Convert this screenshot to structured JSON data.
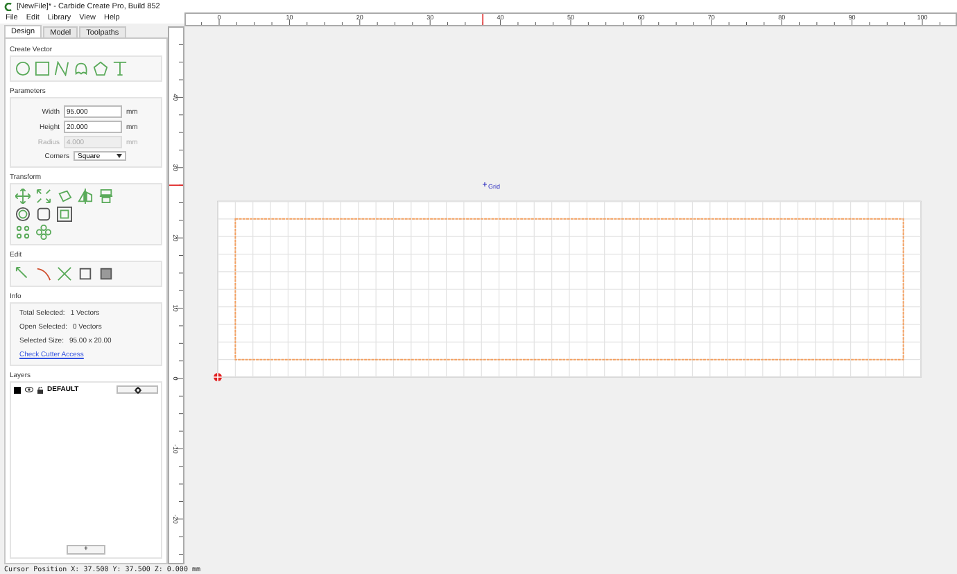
{
  "window": {
    "title": "[NewFile]* - Carbide Create Pro, Build 852"
  },
  "menu": [
    "File",
    "Edit",
    "Library",
    "View",
    "Help"
  ],
  "tabs": [
    {
      "label": "Design",
      "selected": true
    },
    {
      "label": "Model",
      "selected": false
    },
    {
      "label": "Toolpaths",
      "selected": false
    }
  ],
  "create_vector": {
    "title": "Create Vector"
  },
  "parameters": {
    "title": "Parameters",
    "fields": [
      {
        "label": "Width",
        "value": "95.000",
        "unit": "mm",
        "disabled": false
      },
      {
        "label": "Height",
        "value": "20.000",
        "unit": "mm",
        "disabled": false
      },
      {
        "label": "Radius",
        "value": "4.000",
        "unit": "mm",
        "disabled": true
      }
    ],
    "corners": {
      "label": "Corners",
      "value": "Square"
    }
  },
  "transform": {
    "title": "Transform"
  },
  "edit": {
    "title": "Edit"
  },
  "info": {
    "title": "Info",
    "lines": [
      {
        "label": "Total Selected:",
        "value": "1 Vectors"
      },
      {
        "label": "Open Selected:",
        "value": "0 Vectors"
      },
      {
        "label": "Selected Size:",
        "value": "95.00 x 20.00"
      }
    ],
    "link": "Check Cutter Access"
  },
  "layers": {
    "title": "Layers",
    "items": [
      {
        "name": "DEFAULT",
        "color": "#000000"
      }
    ],
    "add_button": "+"
  },
  "canvas": {
    "grid_label": "Grid",
    "x_ruler": [
      "0",
      "10",
      "20",
      "30",
      "40",
      "50",
      "60",
      "70",
      "80",
      "90",
      "100"
    ],
    "y_ruler": [
      "40",
      "30",
      "20",
      "10",
      "0",
      "-10",
      "-20"
    ]
  },
  "status_bar": "Cursor Position X: 37.500 Y: 37.500 Z: 0.000 mm"
}
